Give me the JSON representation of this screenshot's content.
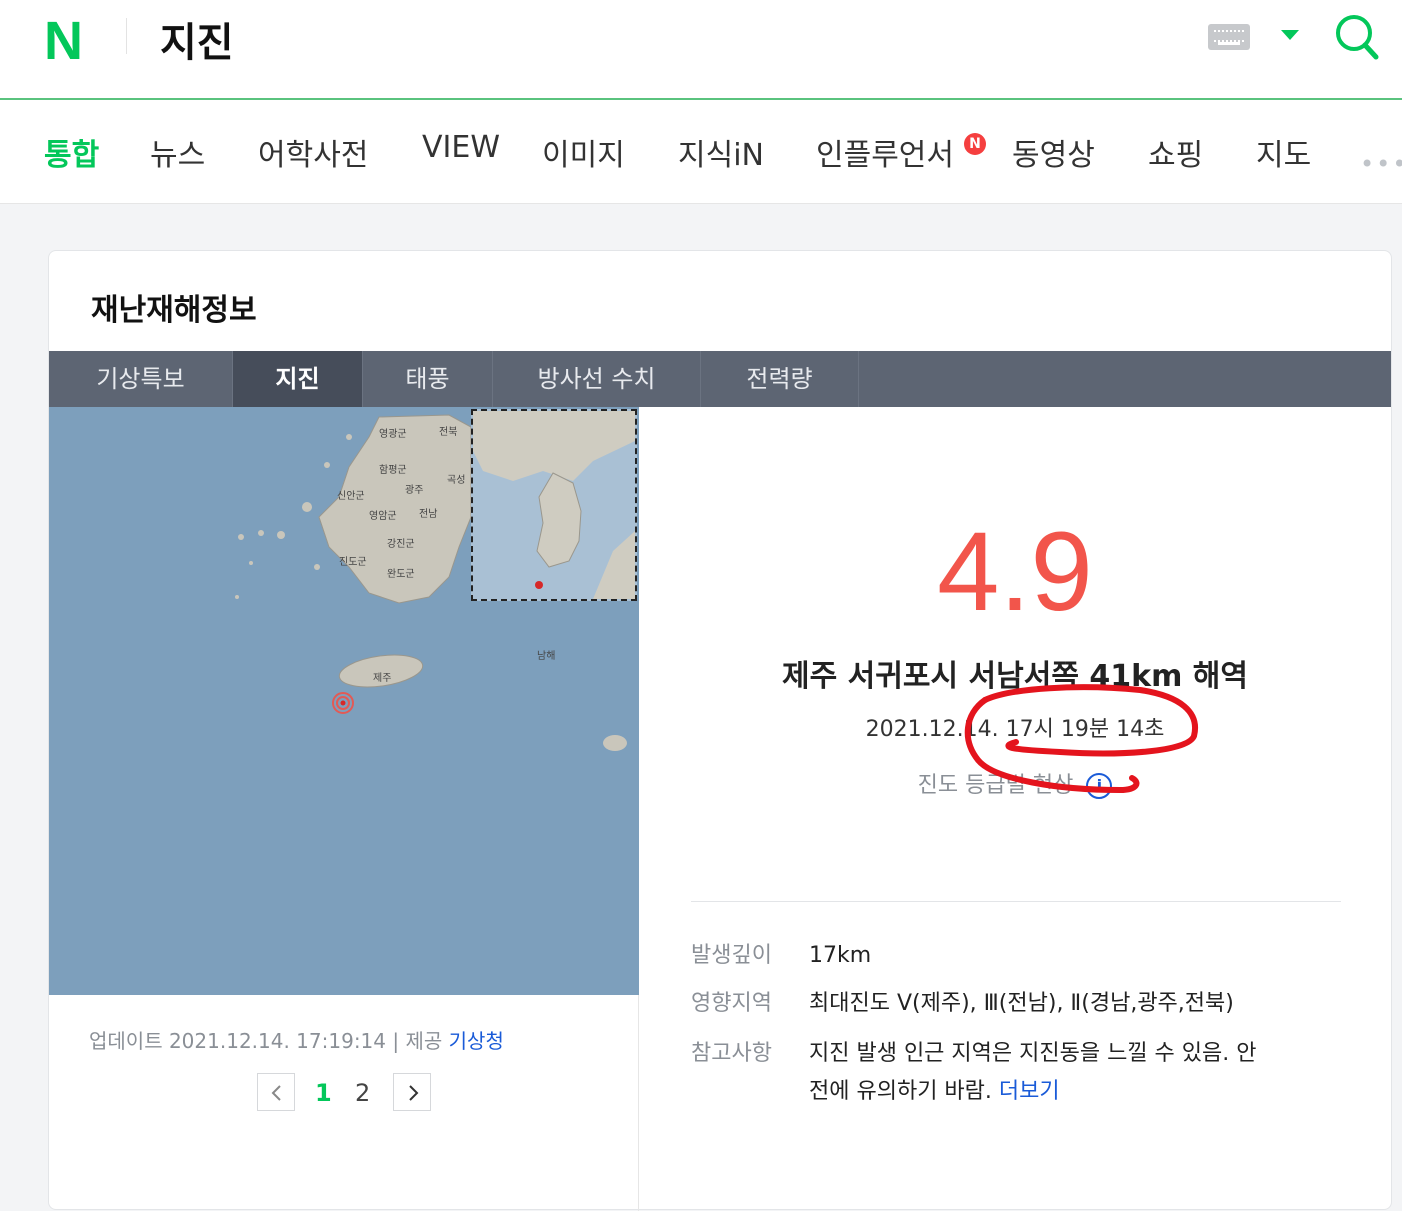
{
  "header": {
    "logo": "N",
    "query": "지진"
  },
  "tabs": [
    {
      "label": "통합",
      "active": true
    },
    {
      "label": "뉴스"
    },
    {
      "label": "어학사전"
    },
    {
      "label": "VIEW"
    },
    {
      "label": "이미지"
    },
    {
      "label": "지식iN"
    },
    {
      "label": "인플루언서"
    },
    {
      "label": "동영상"
    },
    {
      "label": "쇼핑"
    },
    {
      "label": "지도"
    }
  ],
  "badge": "N",
  "more": "•••",
  "card": {
    "title": "재난재해정보",
    "subtabs": [
      {
        "label": "기상특보"
      },
      {
        "label": "지진",
        "active": true
      },
      {
        "label": "태풍"
      },
      {
        "label": "방사선 수치"
      },
      {
        "label": "전력량"
      }
    ]
  },
  "map": {
    "labels": [
      "영광군",
      "전북",
      "함평군",
      "광주",
      "곡성",
      "신안군",
      "영암군",
      "전남",
      "강진군",
      "진도군",
      "완도군",
      "제주",
      "남해"
    ]
  },
  "quake": {
    "magnitude": "4.9",
    "location": "제주 서귀포시 서남서쪽 41km 해역",
    "time": "2021.12.14. 17시 19분 14초",
    "intensity_label": "진도 등급별 현상",
    "info_icon": "i",
    "details": [
      {
        "key": "발생깊이",
        "value": "17km"
      },
      {
        "key": "영향지역",
        "value": "최대진도 Ⅴ(제주), Ⅲ(전남), Ⅱ(경남,광주,전북)"
      },
      {
        "key": "참고사항",
        "value": "지진 발생 인근 지역은 지진동을 느낄 수 있음. 안",
        "value2": "전에 유의하기 바람.",
        "link": "더보기"
      }
    ]
  },
  "update": {
    "label": "업데이트 2021.12.14. 17:19:14",
    "provider_label": "제공",
    "provider": "기상청"
  },
  "pager": {
    "pages": [
      "1",
      "2"
    ],
    "current": "1"
  },
  "colors": {
    "brand": "#03c75a",
    "magnitude": "#f2554b",
    "link": "#1a5bd8",
    "annotation": "#e4141d"
  }
}
